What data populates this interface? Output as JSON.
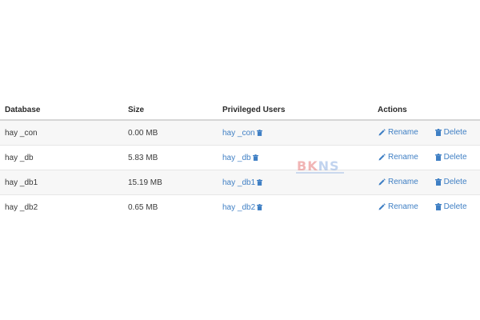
{
  "table": {
    "headers": {
      "database": "Database",
      "size": "Size",
      "users": "Privileged Users",
      "actions": "Actions"
    },
    "rows": [
      {
        "database": "hay     _con",
        "size": "0.00 MB",
        "user": "hay     _con"
      },
      {
        "database": "hay     _db",
        "size": "5.83 MB",
        "user": "hay     _db"
      },
      {
        "database": "hay     _db1",
        "size": "15.19 MB",
        "user": "hay     _db1"
      },
      {
        "database": "hay     _db2",
        "size": "0.65 MB",
        "user": "hay     _db2"
      }
    ],
    "rename_label": "Rename",
    "delete_label": "Delete"
  },
  "watermark": {
    "prefix": "BK",
    "suffix": "NS"
  },
  "icons": {
    "rename": "pencil-icon",
    "delete": "trash-icon",
    "user_remove": "trash-icon"
  },
  "colors": {
    "link": "#3f7fc4",
    "stripe": "#f7f7f7",
    "header_border": "#d6d6d6"
  }
}
